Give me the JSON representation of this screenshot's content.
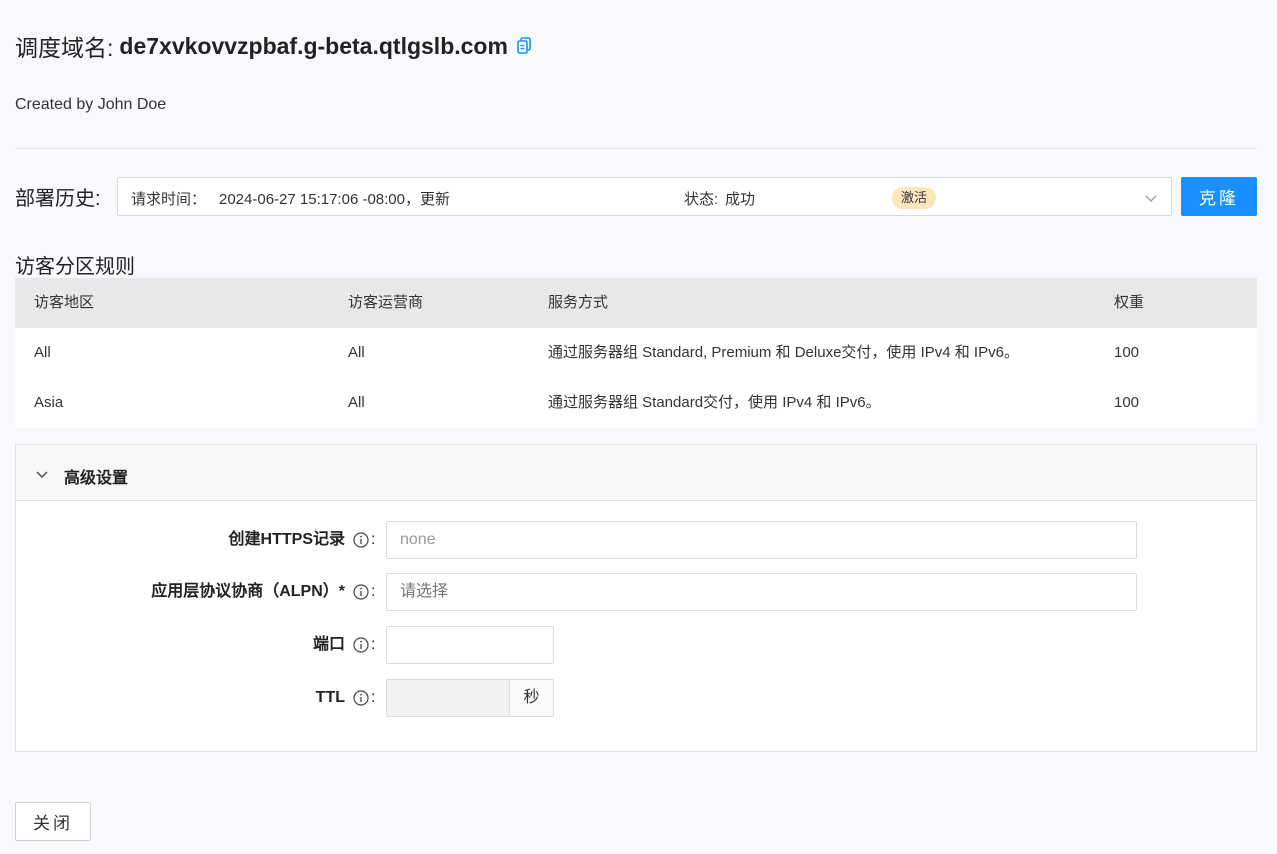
{
  "header": {
    "title_prefix": "调度域名:",
    "domain": "de7xvkovvzpbaf.g-beta.qtlgslb.com",
    "created_by": "Created by John Doe"
  },
  "deploy": {
    "label": "部署历史:",
    "request_label": "请求时间：",
    "request_value": "2024-06-27 15:17:06 -08:00，更新",
    "status_label": "状态:",
    "status_value": "成功",
    "badge": "激活",
    "clone_button": "克隆"
  },
  "rules": {
    "title": "访客分区规则",
    "columns": [
      "访客地区",
      "访客运营商",
      "服务方式",
      "权重"
    ],
    "rows": [
      [
        "All",
        "All",
        "通过服务器组 Standard, Premium 和 Deluxe交付，使用 IPv4 和 IPv6。",
        "100"
      ],
      [
        "Asia",
        "All",
        "通过服务器组 Standard交付，使用 IPv4 和 IPv6。",
        "100"
      ]
    ]
  },
  "advanced": {
    "title": "高级设置",
    "https_label": "创建HTTPS记录",
    "https_value": "none",
    "alpn_label": "应用层协议协商（ALPN）*",
    "alpn_placeholder": "请选择",
    "port_label": "端口",
    "port_value": "",
    "ttl_label": "TTL",
    "ttl_unit": "秒",
    "colon": ":"
  },
  "footer": {
    "close_button": "关闭"
  },
  "colors": {
    "primary": "#1890ff",
    "badge_bg": "#fde6bd",
    "table_header_bg": "#e8e8e8"
  }
}
